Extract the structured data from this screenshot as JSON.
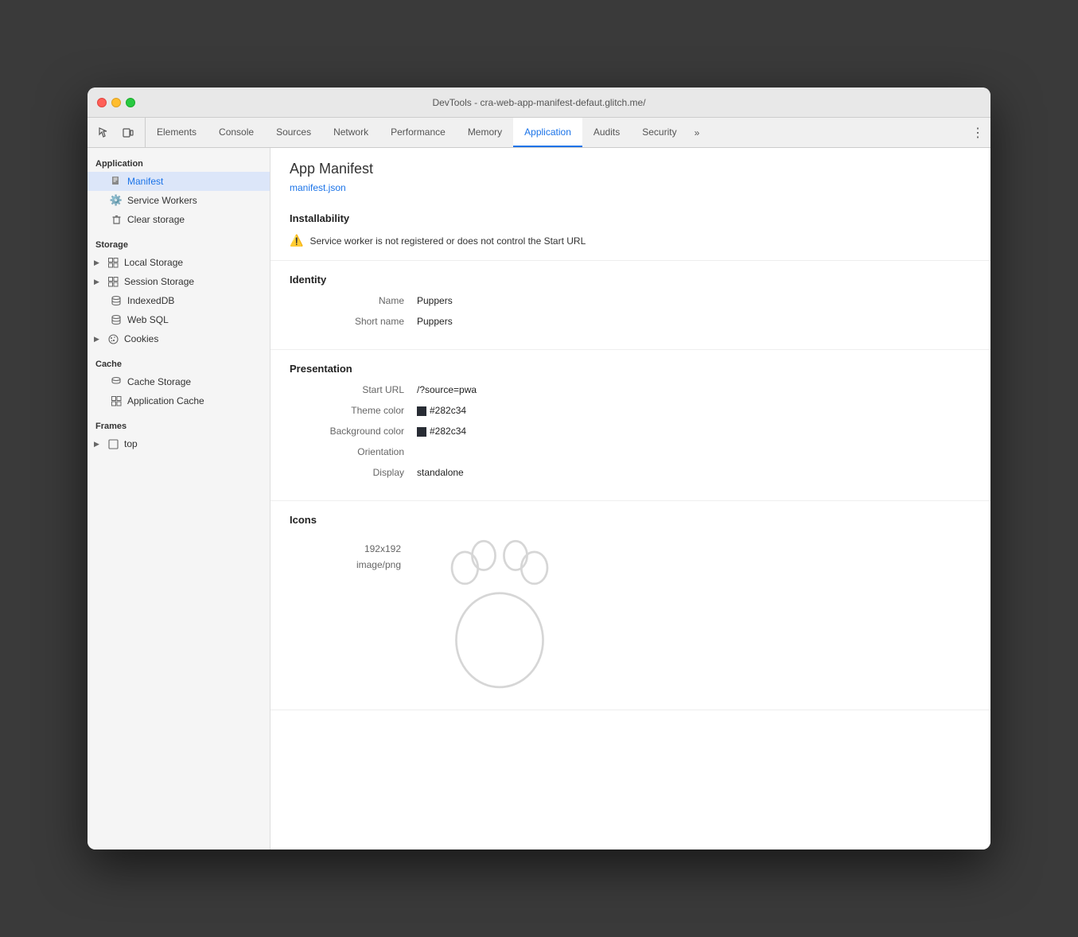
{
  "window": {
    "title": "DevTools - cra-web-app-manifest-defaut.glitch.me/"
  },
  "tabbar": {
    "icons": [
      {
        "name": "cursor-icon",
        "symbol": "↖"
      },
      {
        "name": "device-icon",
        "symbol": "⬜"
      }
    ],
    "tabs": [
      {
        "id": "elements",
        "label": "Elements",
        "active": false
      },
      {
        "id": "console",
        "label": "Console",
        "active": false
      },
      {
        "id": "sources",
        "label": "Sources",
        "active": false
      },
      {
        "id": "network",
        "label": "Network",
        "active": false
      },
      {
        "id": "performance",
        "label": "Performance",
        "active": false
      },
      {
        "id": "memory",
        "label": "Memory",
        "active": false
      },
      {
        "id": "application",
        "label": "Application",
        "active": true
      },
      {
        "id": "audits",
        "label": "Audits",
        "active": false
      },
      {
        "id": "security",
        "label": "Security",
        "active": false
      }
    ],
    "overflow_label": "»",
    "menu_label": "⋮"
  },
  "sidebar": {
    "sections": [
      {
        "id": "application-section",
        "label": "Application",
        "items": [
          {
            "id": "manifest",
            "label": "Manifest",
            "icon": "📄",
            "active": true,
            "indented": false
          },
          {
            "id": "service-workers",
            "label": "Service Workers",
            "icon": "⚙️",
            "active": false,
            "indented": false
          },
          {
            "id": "clear-storage",
            "label": "Clear storage",
            "icon": "🗑️",
            "active": false,
            "indented": false
          }
        ]
      },
      {
        "id": "storage-section",
        "label": "Storage",
        "items": [
          {
            "id": "local-storage",
            "label": "Local Storage",
            "icon": "▦",
            "active": false,
            "arrow": true
          },
          {
            "id": "session-storage",
            "label": "Session Storage",
            "icon": "▦",
            "active": false,
            "arrow": true
          },
          {
            "id": "indexeddb",
            "label": "IndexedDB",
            "icon": "🗄",
            "active": false,
            "arrow": false
          },
          {
            "id": "web-sql",
            "label": "Web SQL",
            "icon": "🗄",
            "active": false,
            "arrow": false
          },
          {
            "id": "cookies",
            "label": "Cookies",
            "icon": "🍪",
            "active": false,
            "arrow": true
          }
        ]
      },
      {
        "id": "cache-section",
        "label": "Cache",
        "items": [
          {
            "id": "cache-storage",
            "label": "Cache Storage",
            "icon": "🗄",
            "active": false,
            "arrow": false
          },
          {
            "id": "application-cache",
            "label": "Application Cache",
            "icon": "▦",
            "active": false,
            "arrow": false
          }
        ]
      },
      {
        "id": "frames-section",
        "label": "Frames",
        "items": [
          {
            "id": "top-frame",
            "label": "top",
            "icon": "⬜",
            "active": false,
            "arrow": true
          }
        ]
      }
    ]
  },
  "content": {
    "title": "App Manifest",
    "manifest_link": "manifest.json",
    "installability": {
      "section_title": "Installability",
      "warning_text": "Service worker is not registered or does not control the Start URL"
    },
    "identity": {
      "section_title": "Identity",
      "name_label": "Name",
      "name_value": "Puppers",
      "short_name_label": "Short name",
      "short_name_value": "Puppers"
    },
    "presentation": {
      "section_title": "Presentation",
      "start_url_label": "Start URL",
      "start_url_value": "/?source=pwa",
      "theme_color_label": "Theme color",
      "theme_color_value": "#282c34",
      "background_color_label": "Background color",
      "background_color_value": "#282c34",
      "orientation_label": "Orientation",
      "orientation_value": "",
      "display_label": "Display",
      "display_value": "standalone"
    },
    "icons": {
      "section_title": "Icons",
      "size": "192x192",
      "type": "image/png"
    }
  }
}
